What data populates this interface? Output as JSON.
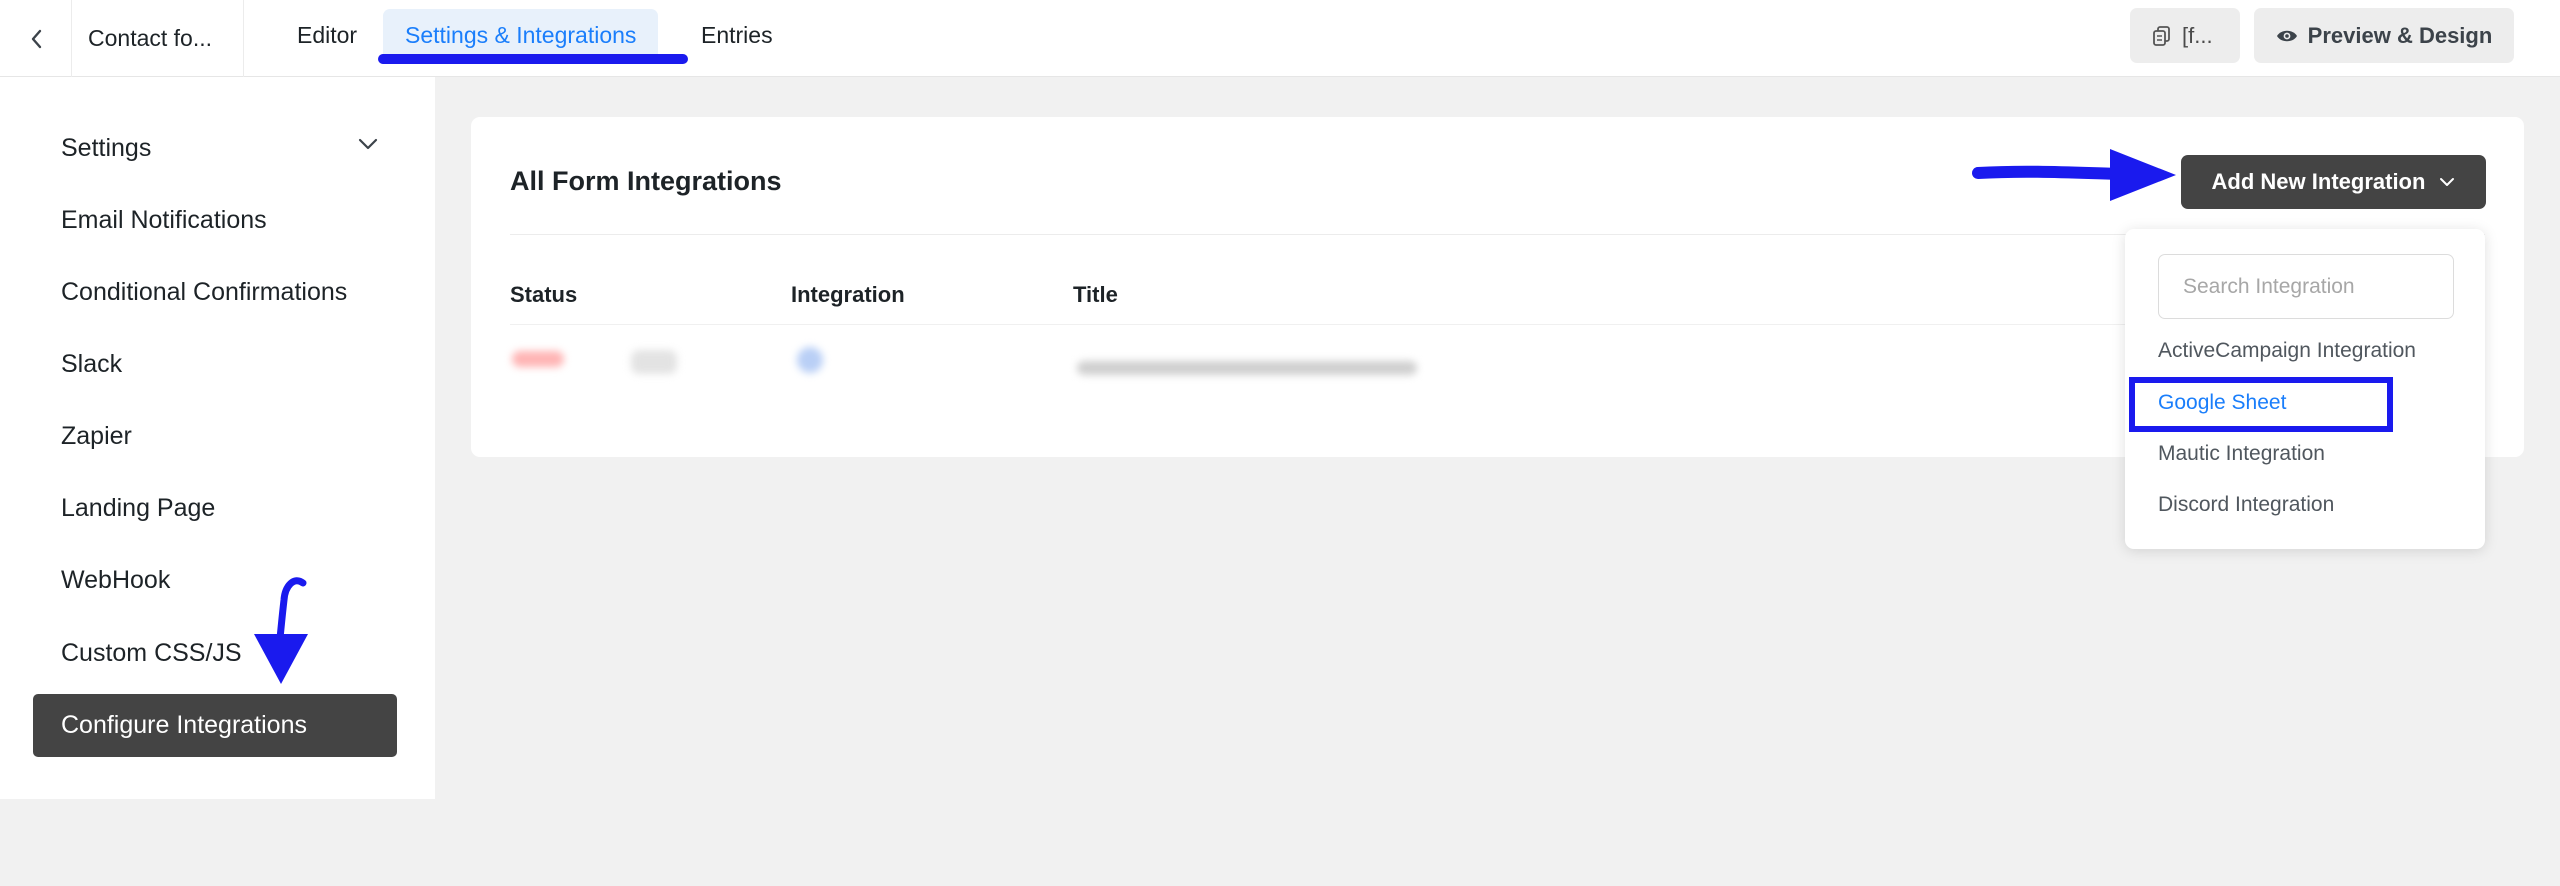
{
  "header": {
    "form_name": "Contact fo...",
    "tabs": [
      {
        "label": "Editor"
      },
      {
        "label": "Settings & Integrations"
      },
      {
        "label": "Entries"
      }
    ],
    "shortcode_label": "[f...",
    "preview_label": "Preview & Design"
  },
  "sidebar": {
    "items": [
      {
        "label": "Settings"
      },
      {
        "label": "Email Notifications"
      },
      {
        "label": "Conditional Confirmations"
      },
      {
        "label": "Slack"
      },
      {
        "label": "Zapier"
      },
      {
        "label": "Landing Page"
      },
      {
        "label": "WebHook"
      },
      {
        "label": "Custom CSS/JS"
      },
      {
        "label": "Configure Integrations"
      }
    ]
  },
  "main": {
    "title": "All Form Integrations",
    "add_button_label": "Add New Integration",
    "columns": [
      "Status",
      "Integration",
      "Title"
    ]
  },
  "dropdown": {
    "search_placeholder": "Search Integration",
    "items": [
      {
        "label": "ActiveCampaign Integration"
      },
      {
        "label": "Google Sheet"
      },
      {
        "label": "Mautic Integration"
      },
      {
        "label": "Discord Integration"
      }
    ]
  },
  "colors": {
    "accent": "#1a7efb",
    "annotation": "#1a1aee",
    "dark_button": "#444444"
  }
}
